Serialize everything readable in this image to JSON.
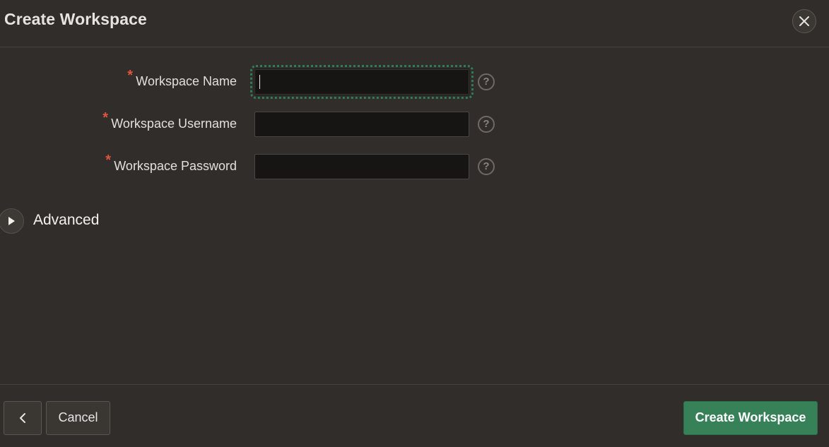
{
  "dialog": {
    "title": "Create Workspace",
    "close_icon": "close-icon"
  },
  "form": {
    "required_marker": "*",
    "fields": [
      {
        "label": "Workspace Name",
        "value": "",
        "focused": true,
        "help_icon": "question-circle-icon",
        "help_glyph": "?"
      },
      {
        "label": "Workspace Username",
        "value": "",
        "focused": false,
        "help_icon": "question-circle-icon",
        "help_glyph": "?"
      },
      {
        "label": "Workspace Password",
        "value": "",
        "focused": false,
        "help_icon": "question-circle-icon",
        "help_glyph": "?"
      }
    ]
  },
  "advanced": {
    "label": "Advanced",
    "expanded": false,
    "toggle_icon": "triangle-right-icon"
  },
  "footer": {
    "back_icon": "chevron-left-icon",
    "cancel_label": "Cancel",
    "create_label": "Create Workspace"
  },
  "colors": {
    "background": "#312d2a",
    "input_background": "#161513",
    "required": "#e0533c",
    "primary_button": "#378158",
    "focus_ring": "#2f7d56"
  }
}
